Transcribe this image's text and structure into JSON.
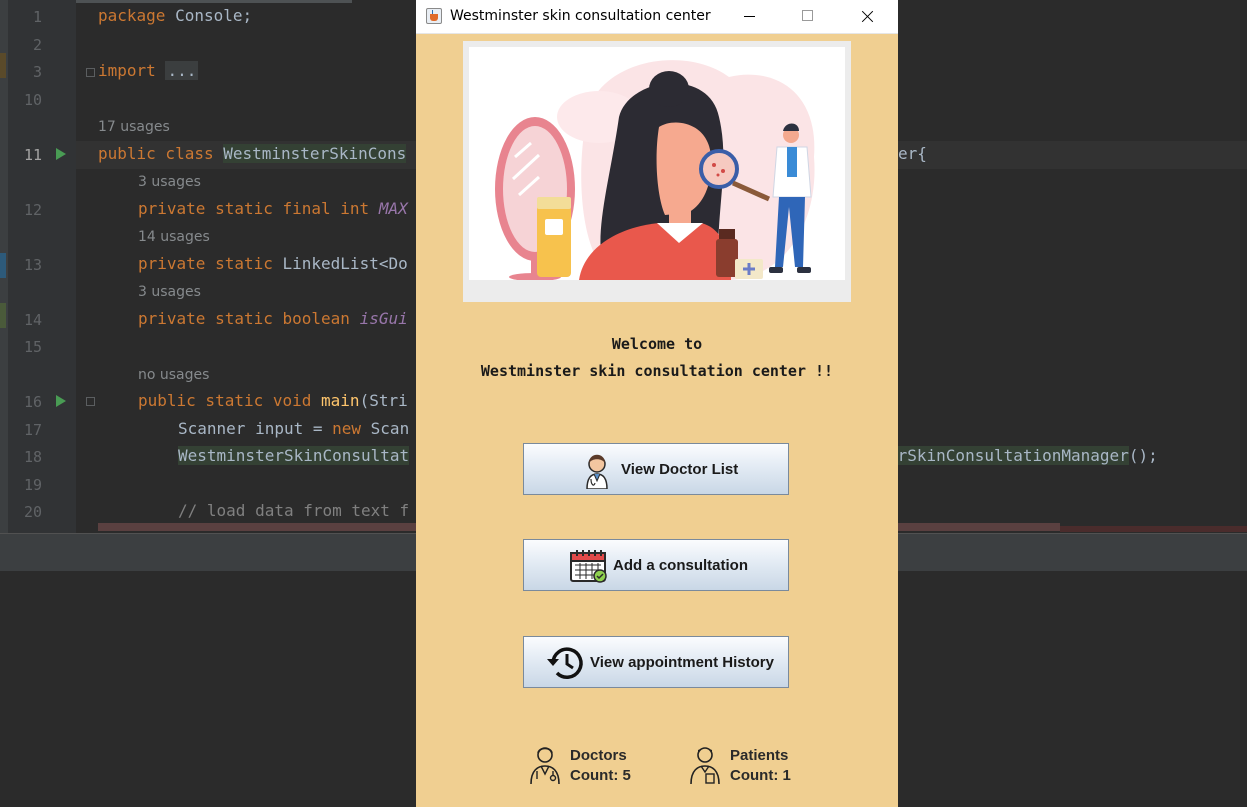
{
  "ide": {
    "line_numbers": [
      "1",
      "2",
      "3",
      "10",
      "11",
      "12",
      "13",
      "14",
      "15",
      "16",
      "17",
      "18",
      "19",
      "20"
    ],
    "lines": {
      "l1": {
        "kw": "package",
        "rest": " Console;"
      },
      "l3": {
        "kw": "import",
        "rest": "..."
      },
      "u11": "17 usages",
      "l11": {
        "kw": "public class ",
        "cls": "WestminsterSkinCons",
        "tail": "er{"
      },
      "u12": "3 usages",
      "l12": {
        "kw": "private static final int ",
        "it": "MAX"
      },
      "u13": "14 usages",
      "l13": {
        "kw": "private static ",
        "rest": "LinkedList<Do"
      },
      "u14": "3 usages",
      "l14": {
        "kw": "private static boolean ",
        "it": "isGui"
      },
      "u16": "no usages",
      "l16": {
        "kw": "public static void ",
        "fn": "main",
        "rest": "(Stri"
      },
      "l17": {
        "a": "Scanner input = ",
        "kw": "new",
        "b": " Scan"
      },
      "l18": {
        "a": "WestminsterSkinConsultat",
        "b": "erSkinConsultationManager",
        "c": "();"
      },
      "l20": {
        "cm": "// load data from text f"
      }
    }
  },
  "window": {
    "title": "Westminster skin consultation center",
    "welcome_line1": "Welcome to",
    "welcome_line2": "Westminster skin consultation center !!",
    "buttons": {
      "view_doctors": "View Doctor List",
      "add_consultation": "Add a consultation",
      "view_history": "View appointment History"
    },
    "stats": {
      "doctors_label": "Doctors",
      "doctors_count": "Count: 5",
      "patients_label": "Patients",
      "patients_count": "Count: 1"
    },
    "icons": {
      "app": "java-cup-icon",
      "doctor": "doctor-avatar-icon",
      "calendar": "calendar-check-icon",
      "history": "history-clock-icon"
    }
  },
  "colors": {
    "window_bg": "#f0cf91",
    "ide_bg": "#2b2b2b",
    "button_gradient_top": "#fbfcfe",
    "button_gradient_bottom": "#c9d7e6"
  }
}
